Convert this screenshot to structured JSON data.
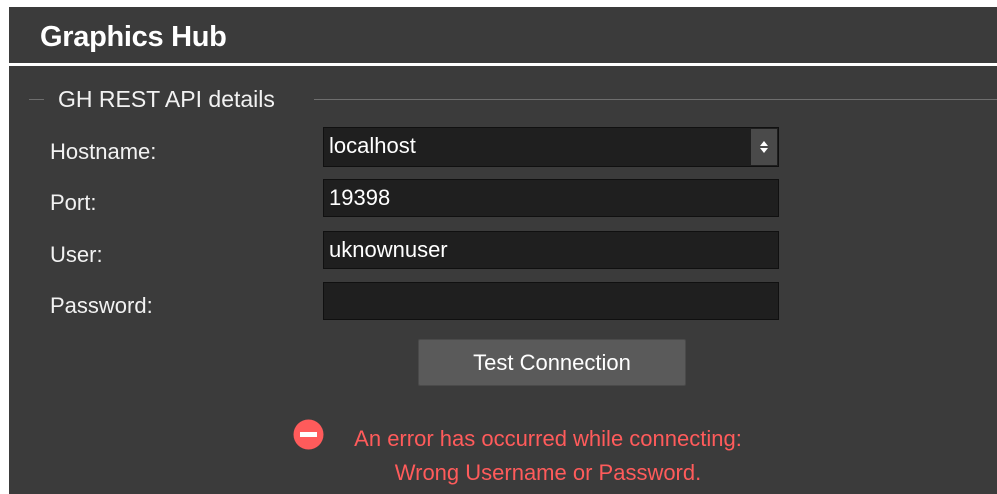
{
  "window": {
    "title": "Graphics Hub"
  },
  "group": {
    "title": "GH REST API details"
  },
  "form": {
    "hostname_label": "Hostname:",
    "hostname_value": "localhost",
    "port_label": "Port:",
    "port_value": "19398",
    "user_label": "User:",
    "user_value": "uknownuser",
    "password_label": "Password:",
    "password_value": ""
  },
  "actions": {
    "test_connection_label": "Test Connection"
  },
  "status": {
    "icon": "error-icon",
    "line1": "An error has occurred while connecting:",
    "line2": "Wrong Username or Password.",
    "color": "#ff5b5b"
  },
  "colors": {
    "panel_bg": "#3b3b3b",
    "field_bg": "#1f1f1f",
    "button_bg": "#5a5a5a",
    "error": "#ff5b5b"
  }
}
